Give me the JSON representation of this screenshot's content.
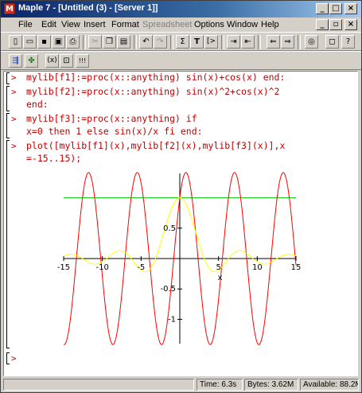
{
  "window": {
    "title": "Maple 7 - [Untitled (3) - [Server 1]]",
    "app_icon": "maple-leaf-icon"
  },
  "menu": [
    {
      "label": "File",
      "enabled": true
    },
    {
      "label": "Edit",
      "enabled": true
    },
    {
      "label": "View",
      "enabled": true
    },
    {
      "label": "Insert",
      "enabled": true
    },
    {
      "label": "Format",
      "enabled": true
    },
    {
      "label": "Spreadsheet",
      "enabled": false
    },
    {
      "label": "Options",
      "enabled": true
    },
    {
      "label": "Window",
      "enabled": true
    },
    {
      "label": "Help",
      "enabled": true
    }
  ],
  "toolbar": {
    "sigma_label": "Σ",
    "text_label": "T",
    "gt_label": "[>"
  },
  "context_toolbar": {
    "paren_label": "(x)",
    "exclaim_label": "!!!"
  },
  "worksheet": {
    "groups": [
      {
        "prompt": ">",
        "lines": [
          "mylib[f1]:=proc(x::anything) sin(x)+cos(x) end:"
        ]
      },
      {
        "prompt": ">",
        "lines": [
          "mylib[f2]:=proc(x::anything) sin(x)^2+cos(x)^2",
          "end:"
        ]
      },
      {
        "prompt": ">",
        "lines": [
          "mylib[f3]:=proc(x::anything) if",
          "x=0 then 1 else sin(x)/x fi end:"
        ]
      },
      {
        "prompt": ">",
        "lines": [
          "plot([mylib[f1](x),mylib[f2](x),mylib[f3](x)],x",
          "=-15..15);"
        ]
      }
    ],
    "empty_prompt": ">"
  },
  "plot": {
    "x_tick_labels": [
      "-15",
      "-10",
      "-5",
      "5",
      "10",
      "15"
    ],
    "y_tick_labels": [
      "0.5",
      "-0.5",
      "-1"
    ],
    "x_axis_label": "x"
  },
  "chart_data": {
    "type": "line",
    "xlim": [
      -15,
      15
    ],
    "ylim": [
      -1.4,
      1.4
    ],
    "x_ticks": [
      -15,
      -10,
      -5,
      5,
      10,
      15
    ],
    "y_ticks": [
      0.5,
      -0.5,
      -1
    ],
    "xlabel": "x",
    "series": [
      {
        "expr": "sin(x)+cos(x)",
        "color": "#ff0000",
        "style": "solid"
      },
      {
        "expr": "sin(x)^2+cos(x)^2",
        "color": "#00cc00",
        "style": "solid"
      },
      {
        "expr": "sin(x)/x",
        "color": "#ffff00",
        "style": "solid"
      }
    ]
  },
  "status": {
    "time": "Time: 6.3s",
    "bytes": "Bytes: 3.62M",
    "available": "Available: 88.2M"
  },
  "colors": {
    "input_text": "#c00000",
    "title_start": "#0a246a",
    "title_end": "#a6caf0"
  }
}
